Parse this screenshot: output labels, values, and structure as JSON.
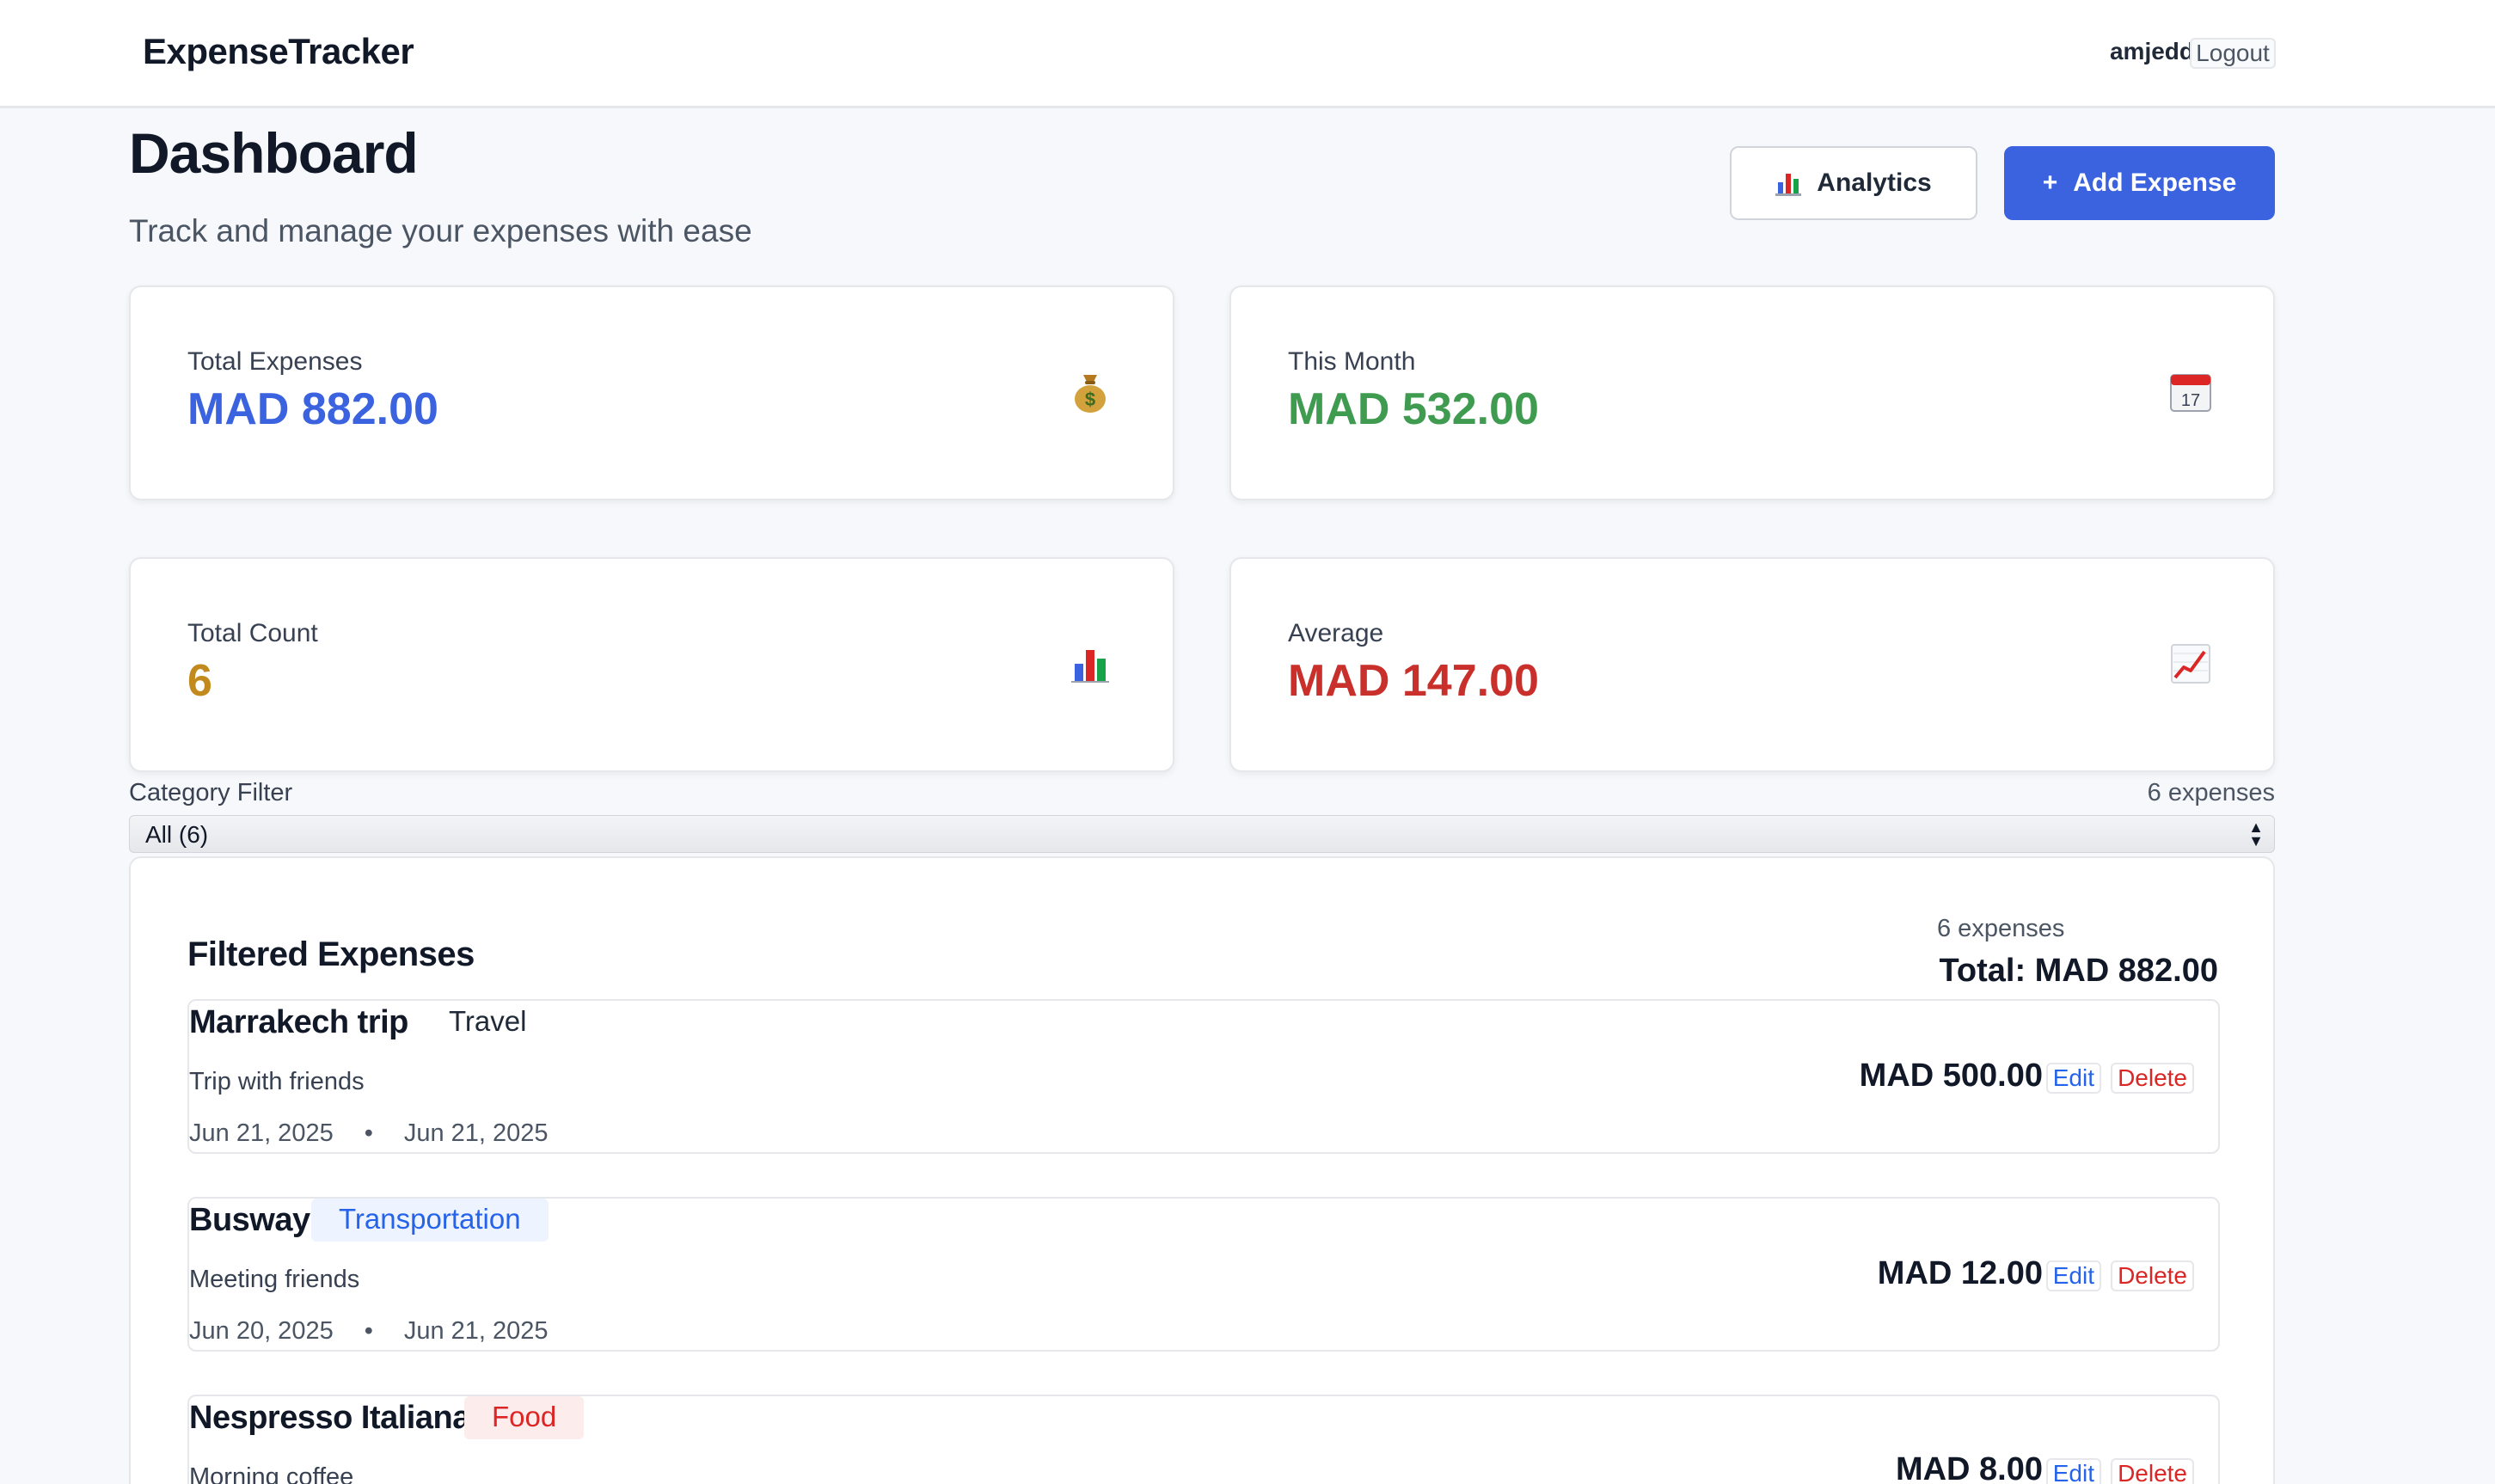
{
  "navbar": {
    "brand": "ExpenseTracker",
    "username": "amjedd",
    "logout_label": "Logout"
  },
  "header": {
    "title": "Dashboard",
    "subtitle": "Track and manage your expenses with ease",
    "analytics_label": "Analytics",
    "analytics_icon": "bar-chart-icon",
    "add_icon": "+",
    "add_label": "Add Expense"
  },
  "stats": [
    {
      "label": "Total Expenses",
      "value": "MAD 882.00",
      "color": "#3b63e0",
      "icon": "money-bag-icon"
    },
    {
      "label": "This Month",
      "value": "MAD 532.00",
      "color": "#3e9b4f",
      "icon": "calendar-icon"
    },
    {
      "label": "Total Count",
      "value": "6",
      "color": "#c28a1c",
      "icon": "bar-chart-icon"
    },
    {
      "label": "Average",
      "value": "MAD 147.00",
      "color": "#c9302c",
      "icon": "trend-up-icon"
    }
  ],
  "filter": {
    "label": "Category Filter",
    "count": "6 expenses",
    "selected": "All (6)"
  },
  "expenses_panel": {
    "title": "Filtered Expenses",
    "count": "6 expenses",
    "total": "Total: MAD 882.00",
    "edit_label": "Edit",
    "delete_label": "Delete",
    "items": [
      {
        "title": "Marrakech trip",
        "category": "Travel",
        "category_bg": "#ffffff",
        "category_color": "#1f2937",
        "description": "Trip with friends",
        "date1": "Jun 21, 2025",
        "date2": "Jun 21, 2025",
        "amount": "MAD 500.00"
      },
      {
        "title": "Busway",
        "category": "Transportation",
        "category_bg": "#eef4ff",
        "category_color": "#2563eb",
        "description": "Meeting friends",
        "date1": "Jun 20, 2025",
        "date2": "Jun 21, 2025",
        "amount": "MAD 12.00"
      },
      {
        "title": "Nespresso Italiana",
        "category": "Food",
        "category_bg": "#fdecec",
        "category_color": "#dc2626",
        "description": "Morning coffee",
        "date1": "",
        "date2": "",
        "amount": "MAD 8.00"
      }
    ]
  }
}
